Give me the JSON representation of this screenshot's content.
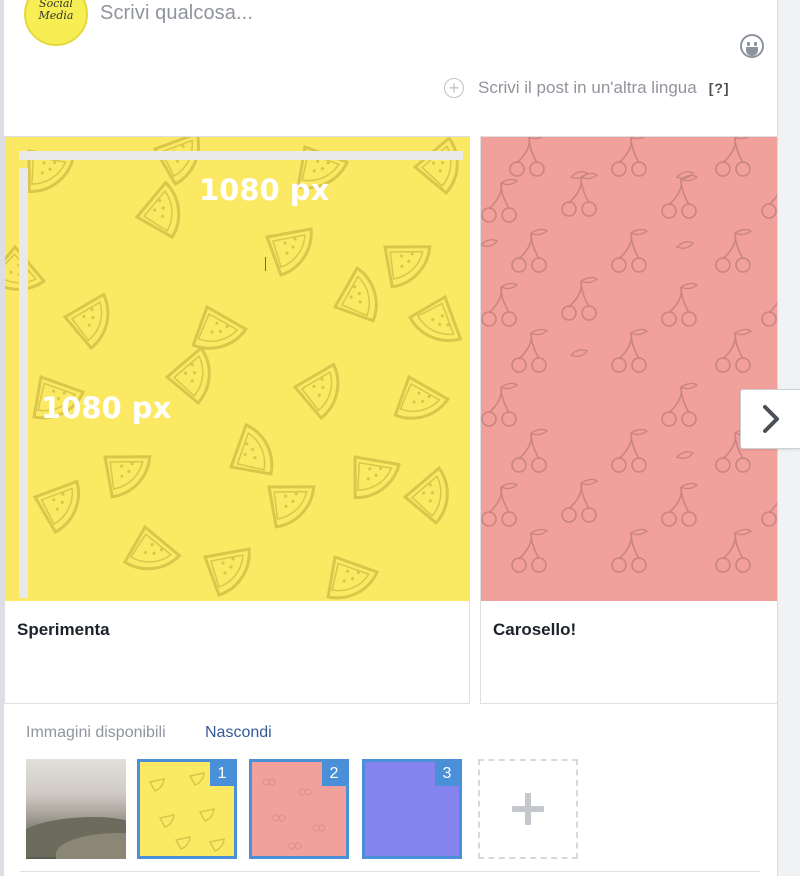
{
  "composer": {
    "avatar_text_1": "Social",
    "avatar_text_2": "Media",
    "placeholder": "Scrivi qualcosa...",
    "emoji_icon": "smiley-icon",
    "translate_label": "Scrivi il post in un'altra lingua",
    "help_label": "[?]"
  },
  "carousel": {
    "cards": [
      {
        "title": "Sperimenta",
        "image": "watermelon-pattern-yellow",
        "overlay_width": "1080 px",
        "overlay_height": "1080 px",
        "color": "#fbe964"
      },
      {
        "title": "Carosello!",
        "image": "cherry-pattern-pink",
        "color": "#f2a09c"
      }
    ],
    "next_icon": "chevron-right-icon"
  },
  "images": {
    "label": "Immagini disponibili",
    "hide_label": "Nascondi",
    "thumbs": [
      {
        "number": "",
        "kind": "landscape-photo"
      },
      {
        "number": "1",
        "color": "#fbe964"
      },
      {
        "number": "2",
        "color": "#f2a09c"
      },
      {
        "number": "3",
        "color": "#8584ee"
      }
    ],
    "add_icon": "plus-icon"
  },
  "colors": {
    "link": "#365899",
    "selected_border": "#4a90d9"
  }
}
